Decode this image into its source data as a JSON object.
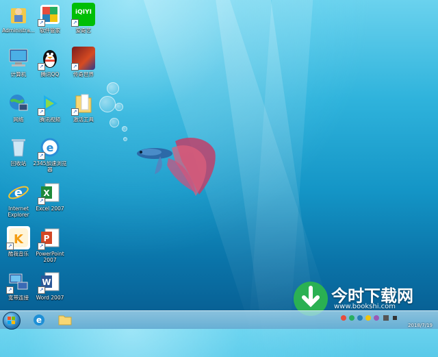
{
  "desktop": {
    "icons": [
      {
        "label": "Administra...",
        "icon": "user-folder-icon"
      },
      {
        "label": "软件管家",
        "icon": "software-manager-icon"
      },
      {
        "label": "爱奇艺",
        "icon": "iqiyi-icon",
        "badge": "iQIYI"
      },
      {
        "label": "计算机",
        "icon": "computer-icon"
      },
      {
        "label": "腾讯QQ",
        "icon": "qq-penguin-icon"
      },
      {
        "label": "传奇世界",
        "icon": "game-icon"
      },
      {
        "label": "网络",
        "icon": "network-globe-icon"
      },
      {
        "label": "腾讯视频",
        "icon": "tencent-video-icon"
      },
      {
        "label": "激活工具",
        "icon": "folder-icon"
      },
      {
        "label": "回收站",
        "icon": "recycle-bin-icon"
      },
      {
        "label": "2345加速浏览器",
        "icon": "browser-e-icon"
      },
      {
        "label": "Internet Explorer",
        "icon": "ie-icon"
      },
      {
        "label": "Excel 2007",
        "icon": "excel-icon"
      },
      {
        "label": "酷我音乐",
        "icon": "kuwo-music-icon"
      },
      {
        "label": "PowerPoint 2007",
        "icon": "powerpoint-icon"
      },
      {
        "label": "宽带连接",
        "icon": "broadband-connection-icon"
      },
      {
        "label": "Word 2007",
        "icon": "word-icon"
      }
    ]
  },
  "taskbar": {
    "clock_date": "2018/7/19"
  },
  "watermark": {
    "title": "今时下载网",
    "url": "www.bookshi.com"
  },
  "colors": {
    "desktop_top": "#6ad2ee",
    "desktop_bottom": "#075a8e",
    "taskbar": "#9fd2ea"
  }
}
